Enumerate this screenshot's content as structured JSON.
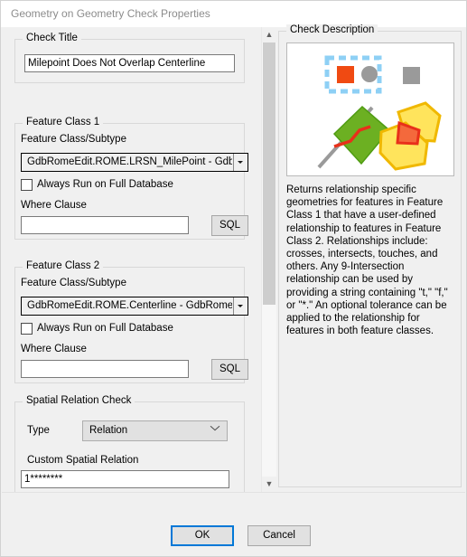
{
  "window": {
    "title": "Geometry on Geometry Check Properties"
  },
  "check_title_group": {
    "legend": "Check Title",
    "value": "Milepoint Does Not Overlap Centerline"
  },
  "feature_class_1": {
    "legend": "Feature Class 1",
    "subtype_label": "Feature Class/Subtype",
    "subtype_value": "GdbRomeEdit.ROME.LRSN_MilePoint -  Gdb",
    "always_run_label": "Always Run on Full Database",
    "always_run_checked": false,
    "where_clause_label": "Where Clause",
    "where_clause_value": "",
    "sql_button": "SQL"
  },
  "feature_class_2": {
    "legend": "Feature Class 2",
    "subtype_label": "Feature Class/Subtype",
    "subtype_value": "GdbRomeEdit.ROME.Centerline -  GdbRome",
    "always_run_label": "Always Run on Full Database",
    "always_run_checked": false,
    "where_clause_label": "Where Clause",
    "where_clause_value": "",
    "sql_button": "SQL"
  },
  "spatial_relation_check": {
    "legend": "Spatial Relation Check",
    "type_label": "Type",
    "type_value": "Relation",
    "custom_relation_label": "Custom Spatial Relation",
    "custom_relation_value": "1********"
  },
  "check_description": {
    "legend": "Check Description",
    "text": "Returns relationship specific geometries for features in Feature Class 1 that have a user-defined relationship to features in Feature Class 2.  Relationships include: crosses, intersects, touches, and others. Any 9-Intersection relationship can be used by providing a string containing \"t,\" \"f,\" or \"*.\"  An optional tolerance can be applied to the relationship for features in both feature classes."
  },
  "footer": {
    "ok_label": "OK",
    "cancel_label": "Cancel"
  },
  "colors": {
    "accent": "#0078d7",
    "title_text": "#8c8c8c",
    "dialog_bg": "#f0f0f0",
    "illus_orange": "#f04a12",
    "illus_green": "#6cb022",
    "illus_yellow": "#ffe45c",
    "illus_gray": "#9a9a9a",
    "illus_selection": "#8ed0f5"
  }
}
